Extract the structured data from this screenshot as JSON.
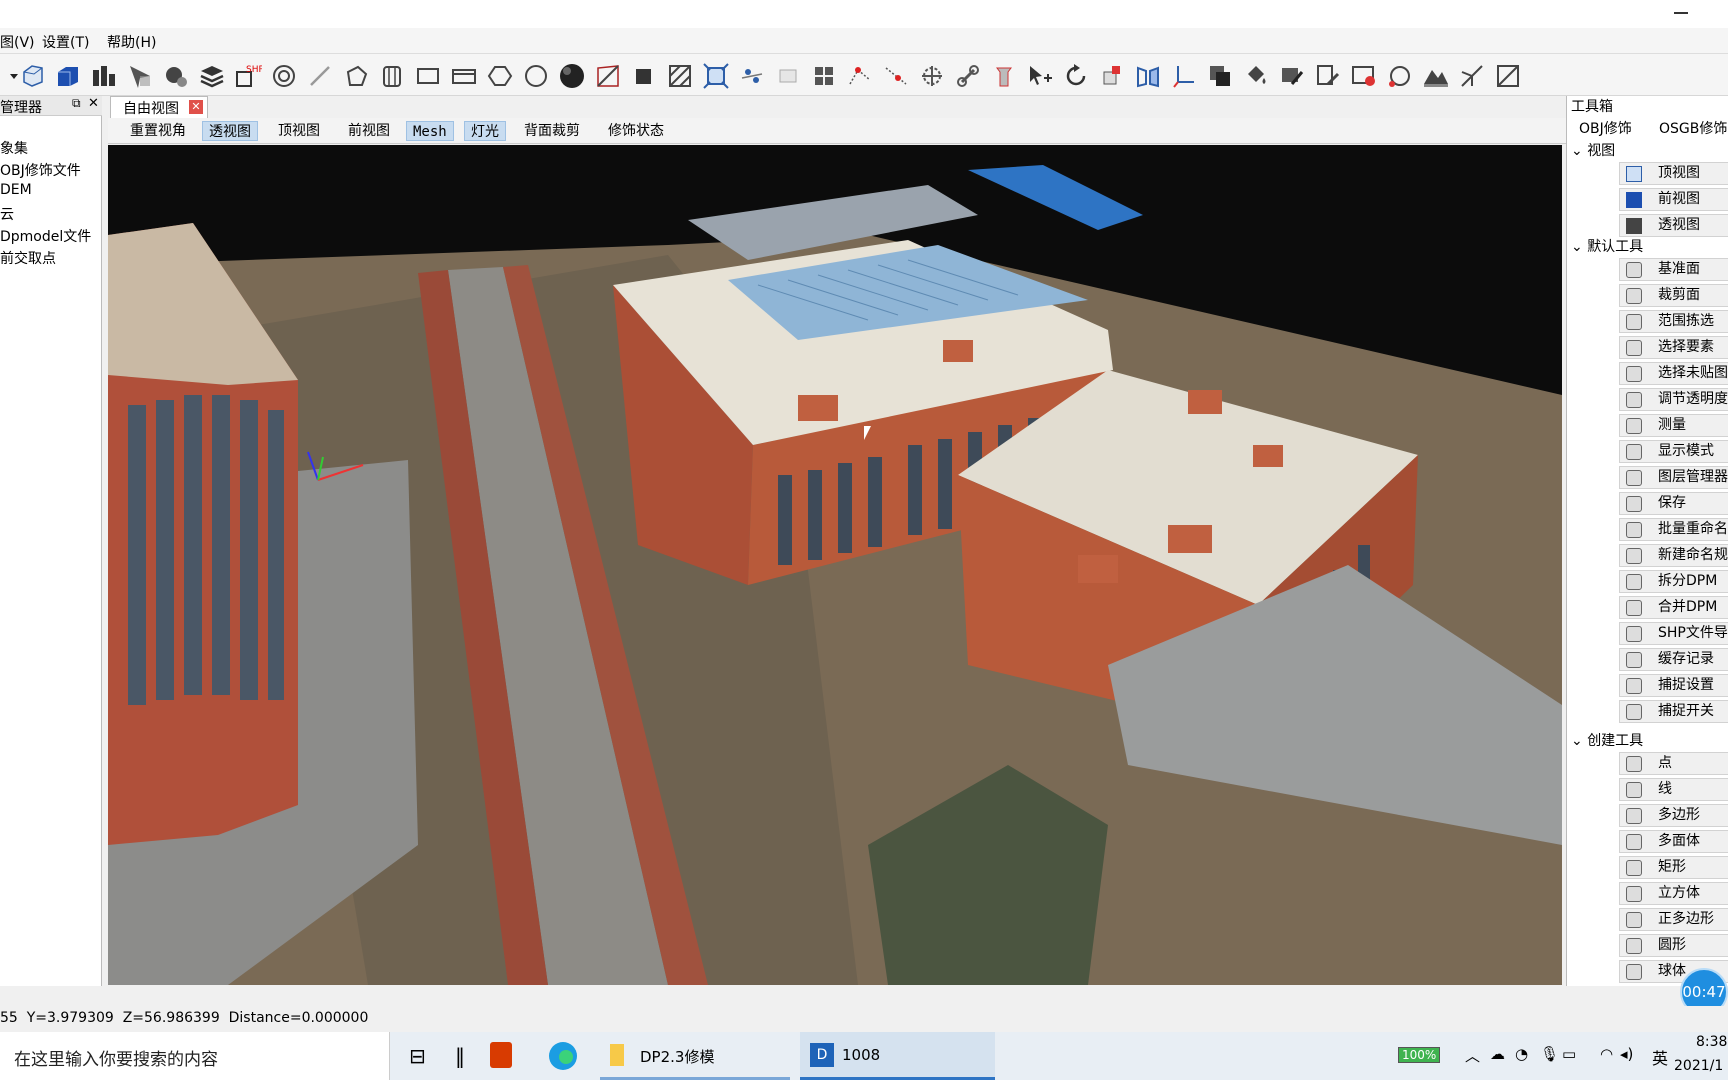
{
  "menu": {
    "view": "图(V)",
    "settings": "设置(T)",
    "help": "帮助(H)"
  },
  "left_panel": {
    "title": "管理器",
    "items": [
      "象集",
      "OBJ修饰文件",
      "DEM",
      "云",
      "Dpmodel文件",
      "前交取点"
    ]
  },
  "doc_tab": {
    "label": "自由视图"
  },
  "view_buttons": [
    "重置视角",
    "透视图",
    "顶视图",
    "前视图",
    "Mesh",
    "灯光",
    "背面裁剪",
    "修饰状态"
  ],
  "active_view_buttons": [
    "透视图",
    "Mesh",
    "灯光"
  ],
  "right_panel": {
    "title": "工具箱",
    "tabs": [
      "OBJ修饰",
      "OSGB修饰"
    ],
    "group_view": "视图",
    "view_tools": [
      "顶视图",
      "前视图",
      "透视图"
    ],
    "group_default": "默认工具",
    "default_tools": [
      "基准面",
      "裁剪面",
      "范围拣选",
      "选择要素",
      "选择未贴图",
      "调节透明度",
      "测量",
      "显示模式",
      "图层管理器",
      "保存",
      "批量重命名",
      "新建命名规",
      "拆分DPM",
      "合并DPM",
      "SHP文件导",
      "缓存记录",
      "捕捉设置",
      "捕捉开关"
    ],
    "group_create": "创建工具",
    "create_tools": [
      "点",
      "线",
      "多边形",
      "多面体",
      "矩形",
      "立方体",
      "正多边形",
      "圆形",
      "球体"
    ]
  },
  "timer": "00:47",
  "status": "55  Y=3.979309  Z=56.986399  Distance=0.000000",
  "taskbar": {
    "search_placeholder": "在这里输入你要搜索的内容",
    "app_folder": "DP2.3修模",
    "app_dp": "1008",
    "battery": "100%",
    "ime": "英",
    "time": "8:38",
    "date": "2021/1"
  },
  "colors": {
    "active_button": "#c8dcf0",
    "timer": "#1f8ee0",
    "brick": "#b85a3a",
    "roof": "#e7e2d6"
  }
}
